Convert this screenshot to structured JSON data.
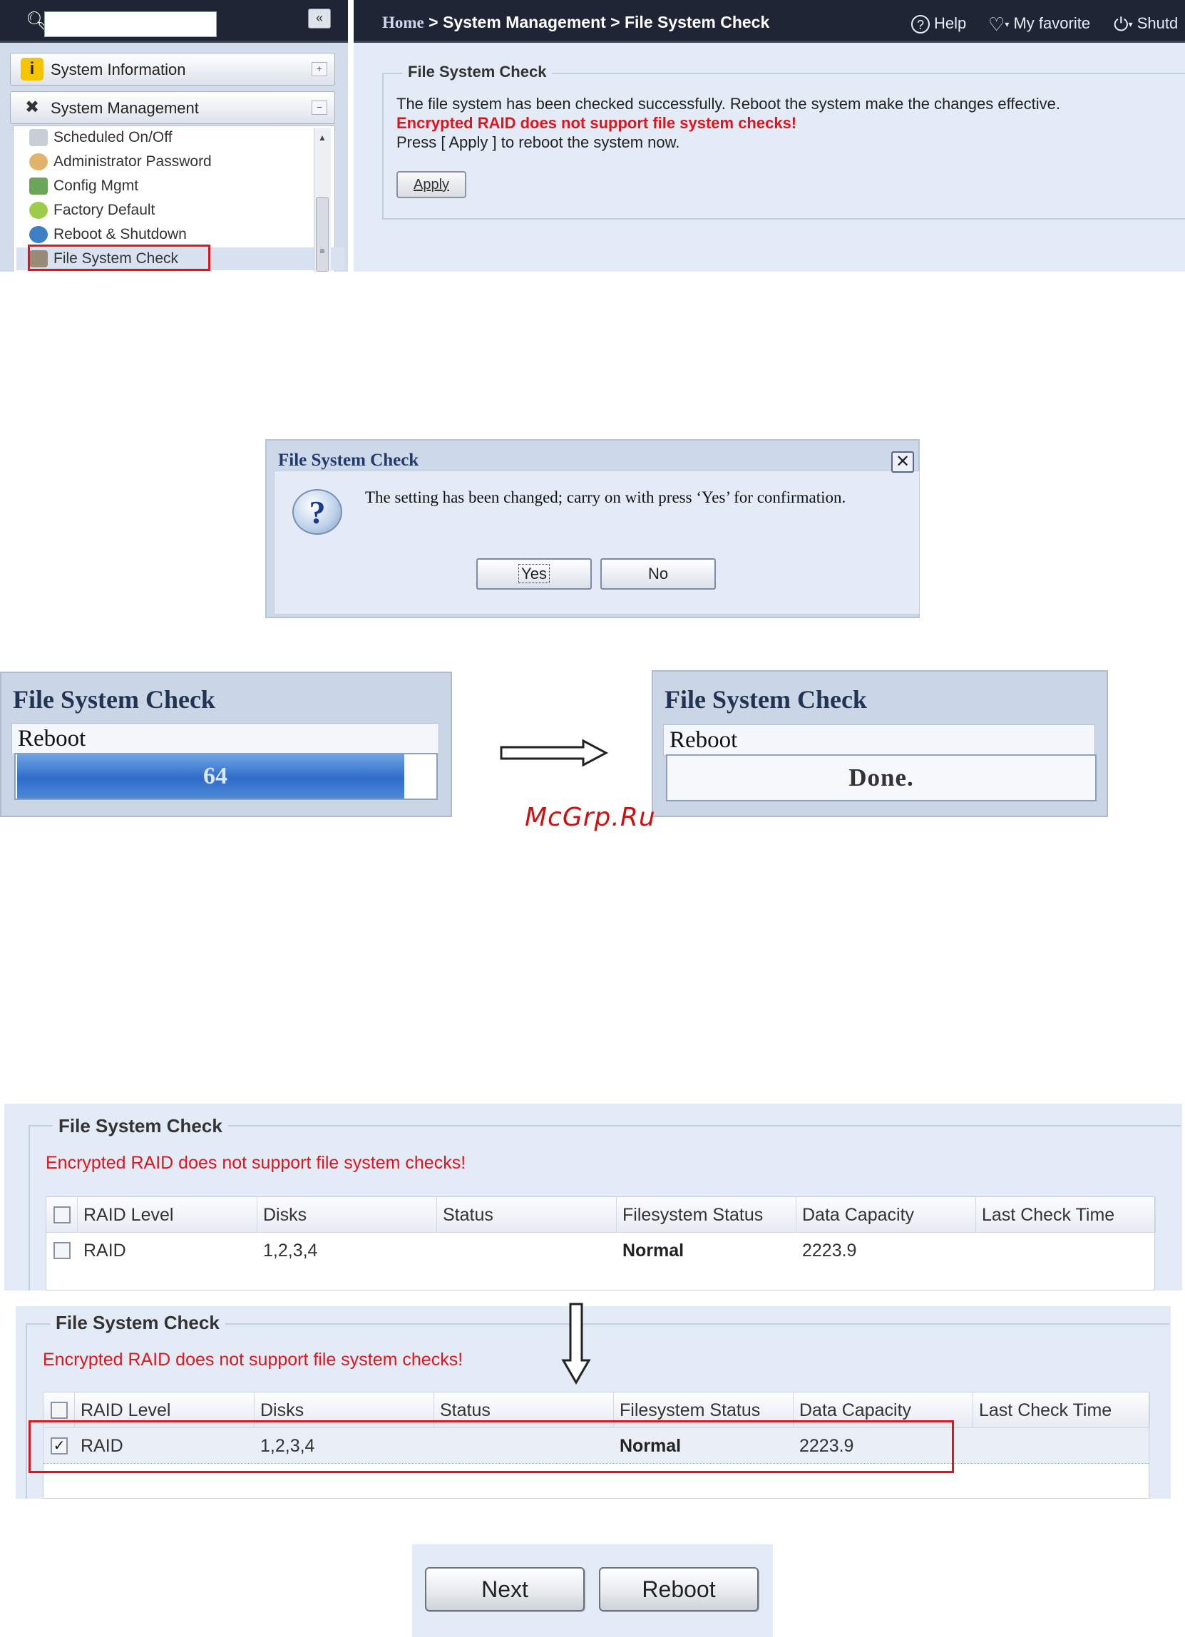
{
  "panel1": {
    "sidebar": {
      "collapse_glyph": "«",
      "sections": [
        {
          "label": "System Information",
          "toggle": "+"
        },
        {
          "label": "System Management",
          "toggle": "−"
        }
      ],
      "items": [
        {
          "label": "Scheduled On/Off"
        },
        {
          "label": "Administrator Password"
        },
        {
          "label": "Config Mgmt"
        },
        {
          "label": "Factory Default"
        },
        {
          "label": "Reboot & Shutdown"
        },
        {
          "label": "File System Check"
        }
      ]
    },
    "topbar": {
      "breadcrumb_home": "Home",
      "breadcrumb_rest": " > System Management > File System Check",
      "help": "Help",
      "favorite": "My favorite",
      "shutdown": "Shutd"
    },
    "main": {
      "legend": "File System Check",
      "line1": "The file system has been checked successfully. Reboot the system make the changes effective.",
      "line2": "Encrypted RAID does not support file system checks!",
      "line3": "Press [ Apply ] to reboot the system now.",
      "apply_label": "Apply"
    }
  },
  "panel2": {
    "title": "File System Check",
    "message": "The setting has been changed; carry on with press ‘Yes’ for confirmation.",
    "yes_label": "Yes",
    "no_label": "No"
  },
  "panel3": {
    "left": {
      "title": "File System Check",
      "label": "Reboot",
      "progress_text": "64",
      "progress": 0.92
    },
    "right": {
      "title": "File System Check",
      "label": "Reboot",
      "status_text": "Done."
    },
    "watermark": "McGrp.Ru"
  },
  "tables": [
    {
      "legend": "File System Check",
      "warning": "Encrypted RAID does not support file system checks!",
      "header": [
        "RAID Level",
        "Disks",
        "Status",
        "Filesystem Status",
        "Data Capacity",
        "Last Check Time"
      ],
      "row": {
        "checked": false,
        "cells": [
          "RAID",
          "1,2,3,4",
          "",
          "Normal",
          "2223.9",
          ""
        ]
      }
    },
    {
      "legend": "File System Check",
      "warning": "Encrypted RAID does not support file system checks!",
      "header": [
        "RAID Level",
        "Disks",
        "Status",
        "Filesystem Status",
        "Data Capacity",
        "Last Check Time"
      ],
      "row": {
        "checked": true,
        "checkmark": "✓",
        "cells": [
          "RAID",
          "1,2,3,4",
          "",
          "Normal",
          "2223.9",
          ""
        ]
      }
    }
  ],
  "panel6": {
    "next_label": "Next",
    "reboot_label": "Reboot"
  }
}
